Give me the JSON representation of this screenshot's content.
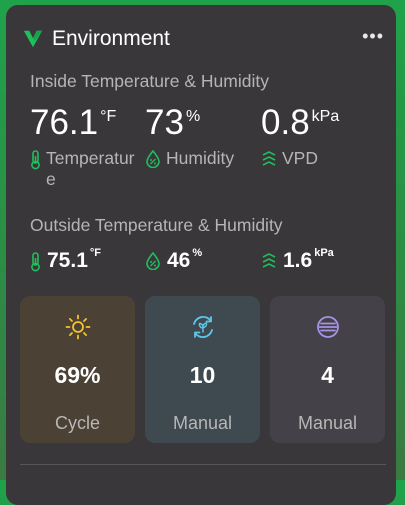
{
  "header": {
    "title": "Environment",
    "menu_label": "•••"
  },
  "inside": {
    "title": "Inside Temperature & Humidity",
    "temperature": {
      "value": "76.1",
      "unit": "°F",
      "label": "Temperature"
    },
    "humidity": {
      "value": "73",
      "unit": "%",
      "label": "Humidity"
    },
    "vpd": {
      "value": "0.8",
      "unit": "kPa",
      "label": "VPD"
    }
  },
  "outside": {
    "title": "Outside Temperature & Humidity",
    "temperature": {
      "value": "75.1",
      "unit": "°F"
    },
    "humidity": {
      "value": "46",
      "unit": "%"
    },
    "vpd": {
      "value": "1.6",
      "unit": "kPa"
    }
  },
  "tiles": [
    {
      "icon": "sun-icon",
      "value": "69%",
      "label": "Cycle",
      "bg": "#4b4235"
    },
    {
      "icon": "refresh-leaf-icon",
      "value": "10",
      "label": "Manual",
      "bg": "#3e4a4f"
    },
    {
      "icon": "fan-lines-icon",
      "value": "4",
      "label": "Manual",
      "bg": "#444149"
    }
  ],
  "colors": {
    "accent": "#1fbf5c",
    "sun": "#f3c330",
    "cyan": "#5cc6ea",
    "violet": "#a792e8",
    "card": "#39373a"
  }
}
